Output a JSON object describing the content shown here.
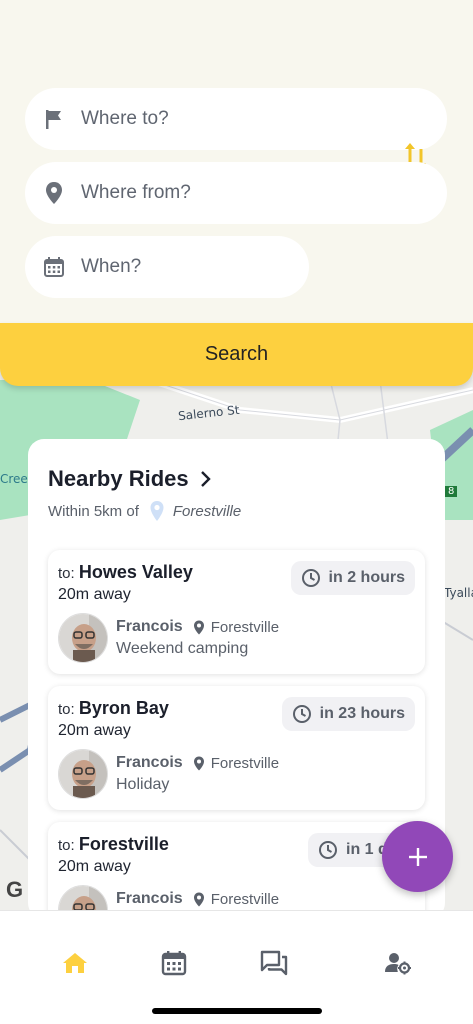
{
  "search": {
    "where_to_placeholder": "Where to?",
    "where_from_placeholder": "Where from?",
    "when_placeholder": "When?",
    "search_label": "Search"
  },
  "map": {
    "street_label": "Salerno St",
    "creek_label": "Cree",
    "tyalla_label": "Tyalla",
    "road_badge": "8"
  },
  "nearby": {
    "title": "Nearby Rides",
    "within_label": "Within 5km of",
    "place": "Forestville"
  },
  "rides": [
    {
      "to_prefix": "to:",
      "destination": "Howes Valley",
      "distance": "20m away",
      "time": "in 2 hours",
      "driver": "Francois",
      "location": "Forestville",
      "note": "Weekend camping"
    },
    {
      "to_prefix": "to:",
      "destination": "Byron Bay",
      "distance": "20m away",
      "time": "in 23 hours",
      "driver": "Francois",
      "location": "Forestville",
      "note": "Holiday"
    },
    {
      "to_prefix": "to:",
      "destination": "Forestville",
      "distance": "20m away",
      "time": "in 1 d",
      "driver": "Francois",
      "location": "Forestville",
      "note": ""
    }
  ],
  "fab_icon": "plus-icon",
  "google_mark": "G",
  "nav": {
    "items": [
      "home-icon",
      "calendar-icon",
      "chat-icon",
      "user-settings-icon"
    ],
    "active": "home-icon"
  },
  "colors": {
    "accent": "#fdd03f",
    "fab": "#9148b8",
    "panel_bg": "#f8f7ee",
    "icon_gray": "#6b7079"
  }
}
